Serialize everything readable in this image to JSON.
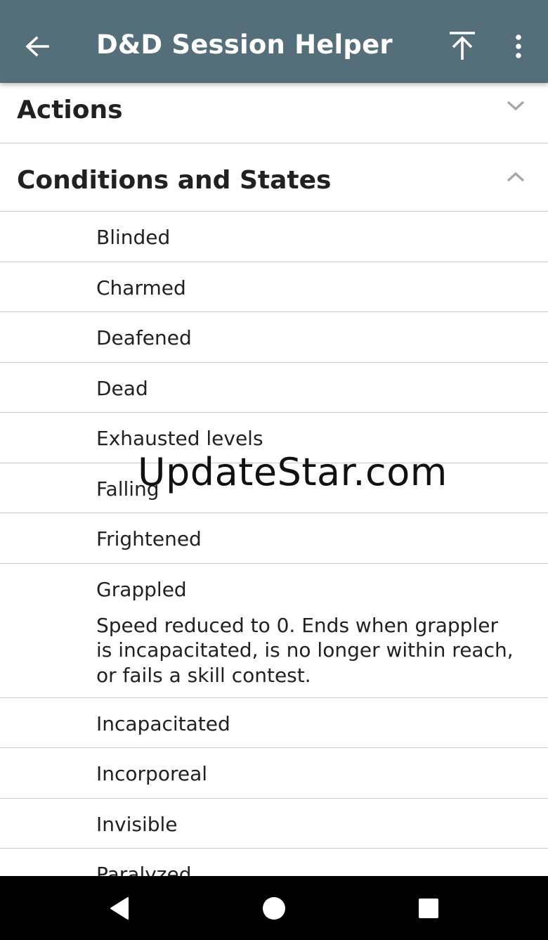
{
  "app_bar": {
    "title": "D&D Session Helper",
    "background": "#546e7a",
    "icons": {
      "back": "arrow-left-icon",
      "scroll_top": "vertical-align-top-icon",
      "more": "more-vertical-icon"
    }
  },
  "sections": {
    "actions": {
      "label": "Actions",
      "state": "collapsed"
    },
    "conditions": {
      "label": "Conditions and States",
      "state": "expanded"
    }
  },
  "conditions": [
    {
      "name": "Blinded"
    },
    {
      "name": "Charmed"
    },
    {
      "name": "Deafened"
    },
    {
      "name": "Dead"
    },
    {
      "name": "Exhausted levels"
    },
    {
      "name": "Falling"
    },
    {
      "name": "Frightened"
    },
    {
      "name": "Grappled",
      "description": "Speed reduced to 0. Ends when grappler is incapacitated, is no longer within reach, or fails a skill contest."
    },
    {
      "name": "Incapacitated"
    },
    {
      "name": "Incorporeal"
    },
    {
      "name": "Invisible"
    },
    {
      "name": "Paralyzed"
    }
  ],
  "watermark": "UpdateStar.com",
  "nav_bar": {
    "back": "triangle-back-icon",
    "home": "circle-home-icon",
    "recents": "square-recents-icon"
  }
}
